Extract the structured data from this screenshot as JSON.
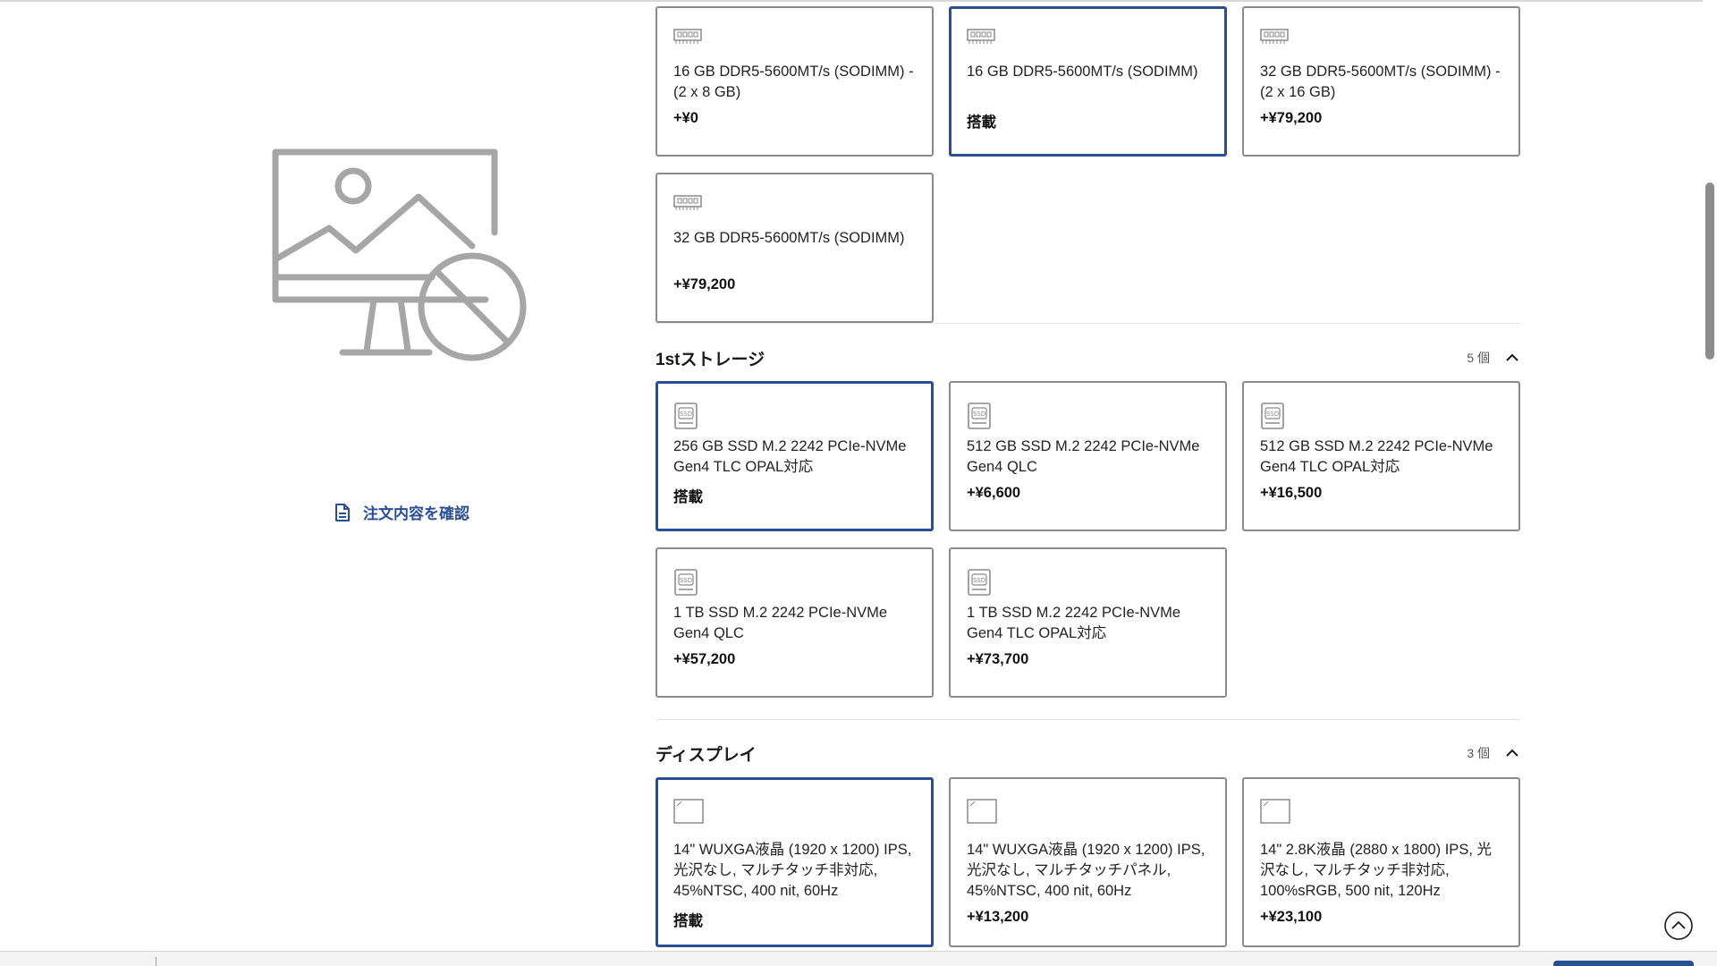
{
  "left": {
    "preview_icon": "no-image-monitor-icon",
    "review_link": "注文内容を確認"
  },
  "memory": {
    "options": [
      {
        "name": "16 GB DDR5-5600MT/s (SODIMM) - (2 x 8 GB)",
        "price": "+¥0",
        "selected": false
      },
      {
        "name": "16 GB DDR5-5600MT/s (SODIMM)",
        "price": "搭載",
        "selected": true
      },
      {
        "name": "32 GB DDR5-5600MT/s (SODIMM) - (2 x 16 GB)",
        "price": "+¥79,200",
        "selected": false
      },
      {
        "name": "32 GB DDR5-5600MT/s (SODIMM)",
        "price": "+¥79,200",
        "selected": false
      }
    ]
  },
  "storage": {
    "title": "1stストレージ",
    "count": "5 個",
    "options": [
      {
        "name": "256 GB SSD M.2 2242 PCIe-NVMe Gen4 TLC OPAL対応",
        "price": "搭載",
        "selected": true
      },
      {
        "name": "512 GB SSD M.2 2242 PCIe-NVMe Gen4 QLC",
        "price": "+¥6,600",
        "selected": false
      },
      {
        "name": "512 GB SSD M.2 2242 PCIe-NVMe Gen4 TLC OPAL対応",
        "price": "+¥16,500",
        "selected": false
      },
      {
        "name": "1 TB SSD M.2 2242 PCIe-NVMe Gen4 QLC",
        "price": "+¥57,200",
        "selected": false
      },
      {
        "name": "1 TB SSD M.2 2242 PCIe-NVMe Gen4 TLC OPAL対応",
        "price": "+¥73,700",
        "selected": false
      }
    ]
  },
  "display": {
    "title": "ディスプレイ",
    "count": "3 個",
    "options": [
      {
        "name": "14\" WUXGA液晶 (1920 x 1200) IPS, 光沢なし, マルチタッチ非対応, 45%NTSC, 400 nit, 60Hz",
        "price": "搭載",
        "selected": true
      },
      {
        "name": "14\" WUXGA液晶 (1920 x 1200) IPS, 光沢なし, マルチタッチパネル, 45%NTSC, 400 nit, 60Hz",
        "price": "+¥13,200",
        "selected": false
      },
      {
        "name": "14\" 2.8K液晶 (2880 x 1800) IPS, 光沢なし, マルチタッチ非対応, 100%sRGB, 500 nit, 120Hz",
        "price": "+¥23,100",
        "selected": false
      }
    ]
  },
  "colors": {
    "accent": "#294e95",
    "border": "#8a8a8a",
    "icon": "#9a9a9a"
  }
}
